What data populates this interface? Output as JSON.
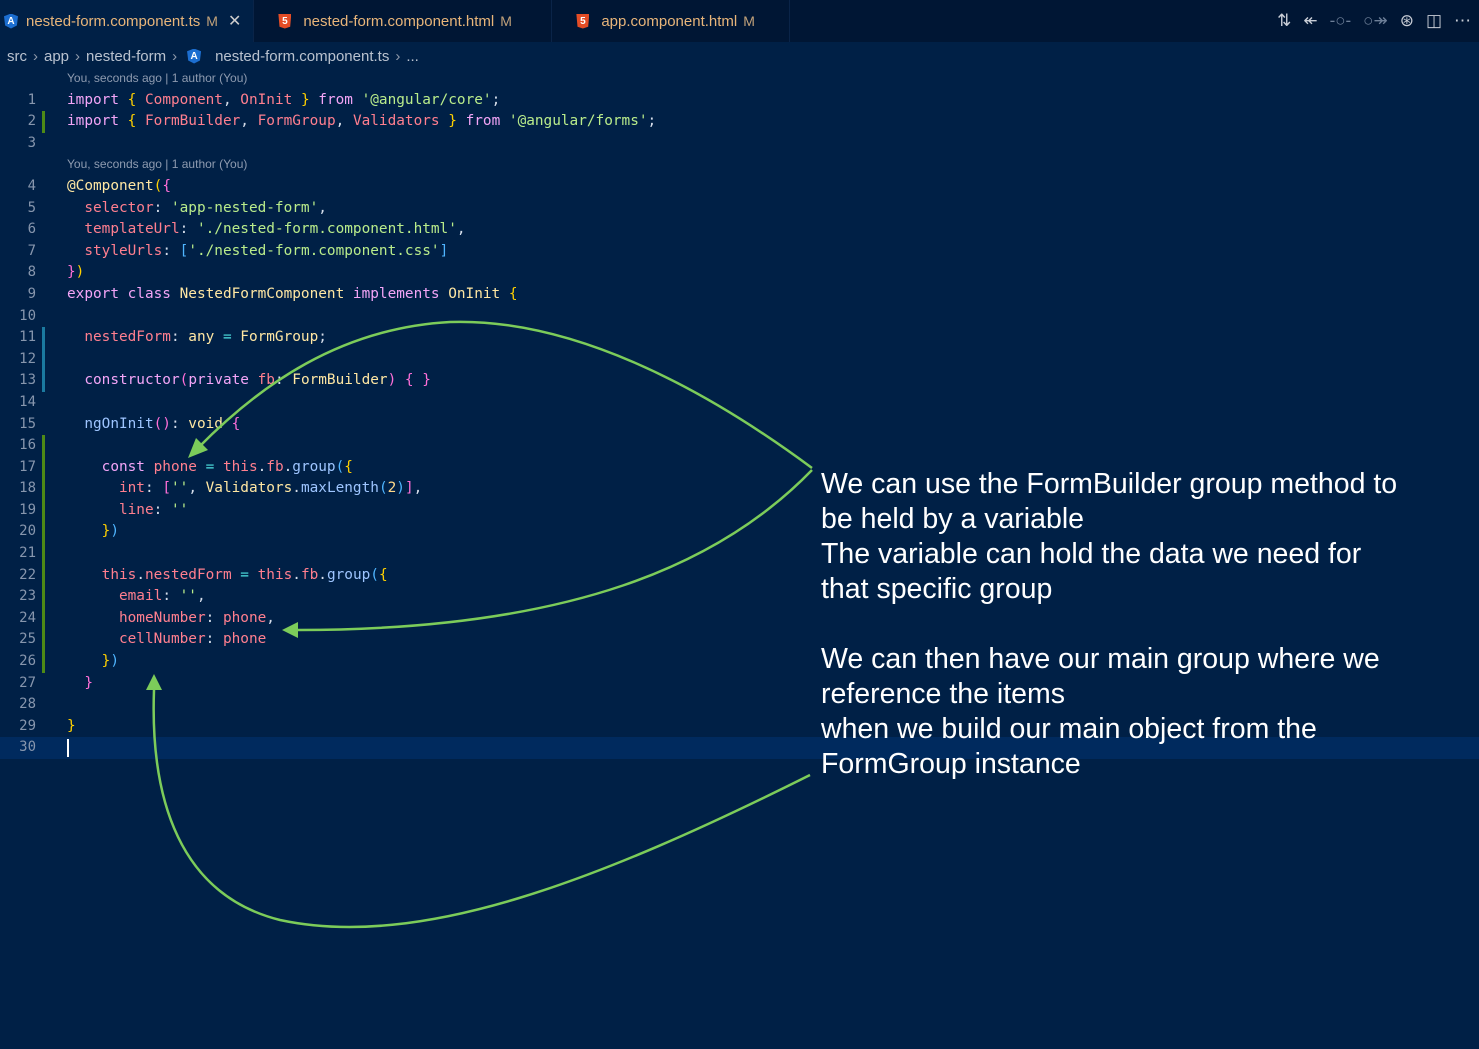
{
  "tabs": [
    {
      "label": "nested-form.component.ts",
      "badge": "M",
      "icon": "angular-icon",
      "active": true
    },
    {
      "label": "nested-form.component.html",
      "badge": "M",
      "icon": "html5-icon"
    },
    {
      "label": "app.component.html",
      "badge": "M",
      "icon": "html5-icon"
    }
  ],
  "breadcrumb": [
    "src",
    "app",
    "nested-form",
    "nested-form.component.ts",
    "..."
  ],
  "blame": "You, seconds ago | 1 author (You)",
  "colors": {
    "background": "#002046",
    "annotation_arrow": "#7ccc5a",
    "added_gutter": "#4e8a16",
    "modified_gutter": "#1b7aa0"
  },
  "lines": [
    [
      [
        "import",
        "kw"
      ],
      [
        " ",
        "pu"
      ],
      [
        "{",
        "br"
      ],
      [
        " Component",
        "id"
      ],
      [
        ",",
        "pu"
      ],
      [
        " OnInit ",
        "id"
      ],
      [
        "}",
        "br"
      ],
      [
        " from ",
        "kw"
      ],
      [
        "'@angular/core'",
        "str"
      ],
      [
        ";",
        "pu"
      ]
    ],
    [
      [
        "import",
        "kw"
      ],
      [
        " ",
        "pu"
      ],
      [
        "{",
        "br"
      ],
      [
        " FormBuilder",
        "id"
      ],
      [
        ",",
        "pu"
      ],
      [
        " FormGroup",
        "id"
      ],
      [
        ",",
        "pu"
      ],
      [
        " Validators ",
        "id"
      ],
      [
        "}",
        "br"
      ],
      [
        " from ",
        "kw"
      ],
      [
        "'@angular/forms'",
        "str"
      ],
      [
        ";",
        "pu"
      ]
    ],
    [],
    [
      [
        "@Component",
        "cls"
      ],
      [
        "(",
        "br"
      ],
      [
        "{",
        "pr"
      ]
    ],
    [
      [
        "  selector",
        "id"
      ],
      [
        ": ",
        "pu"
      ],
      [
        "'app-nested-form'",
        "str"
      ],
      [
        ",",
        "pu"
      ]
    ],
    [
      [
        "  templateUrl",
        "id"
      ],
      [
        ": ",
        "pu"
      ],
      [
        "'./nested-form.component.html'",
        "str"
      ],
      [
        ",",
        "pu"
      ]
    ],
    [
      [
        "  styleUrls",
        "id"
      ],
      [
        ": ",
        "pu"
      ],
      [
        "[",
        "sq"
      ],
      [
        "'./nested-form.component.css'",
        "str"
      ],
      [
        "]",
        "sq"
      ]
    ],
    [
      [
        "}",
        "pr"
      ],
      [
        ")",
        "br"
      ]
    ],
    [
      [
        "export class ",
        "kw"
      ],
      [
        "NestedFormComponent ",
        "cls"
      ],
      [
        "implements ",
        "kw"
      ],
      [
        "OnInit ",
        "cls"
      ],
      [
        "{",
        "br"
      ]
    ],
    [],
    [
      [
        "  nestedForm",
        "id"
      ],
      [
        ": ",
        "pu"
      ],
      [
        "any ",
        "cls"
      ],
      [
        "= ",
        "op"
      ],
      [
        "FormGroup",
        "cls"
      ],
      [
        ";",
        "pu"
      ]
    ],
    [],
    [
      [
        "  constructor",
        "kw"
      ],
      [
        "(",
        "pr"
      ],
      [
        "private ",
        "kw"
      ],
      [
        "fb",
        "id"
      ],
      [
        ": ",
        "pu"
      ],
      [
        "FormBuilder",
        "cls"
      ],
      [
        ")",
        "pr"
      ],
      [
        " { }",
        "pr"
      ]
    ],
    [],
    [
      [
        "  ngOnInit",
        "fn"
      ],
      [
        "()",
        "pr"
      ],
      [
        ": ",
        "pu"
      ],
      [
        "void ",
        "cls"
      ],
      [
        "{",
        "pr"
      ]
    ],
    [],
    [
      [
        "    const ",
        "kw"
      ],
      [
        "phone ",
        "id"
      ],
      [
        "= ",
        "op"
      ],
      [
        "this",
        "id"
      ],
      [
        ".",
        "pu"
      ],
      [
        "fb",
        "id"
      ],
      [
        ".",
        "pu"
      ],
      [
        "group",
        "fn"
      ],
      [
        "(",
        "sq"
      ],
      [
        "{",
        "br"
      ]
    ],
    [
      [
        "      int",
        "id"
      ],
      [
        ": ",
        "pu"
      ],
      [
        "[",
        "pr"
      ],
      [
        "''",
        "str"
      ],
      [
        ", ",
        "pu"
      ],
      [
        "Validators",
        "cls"
      ],
      [
        ".",
        "pu"
      ],
      [
        "maxLength",
        "fn"
      ],
      [
        "(",
        "sq"
      ],
      [
        "2",
        "num"
      ],
      [
        ")",
        "sq"
      ],
      [
        "]",
        "pr"
      ],
      [
        ",",
        "pu"
      ]
    ],
    [
      [
        "      line",
        "id"
      ],
      [
        ": ",
        "pu"
      ],
      [
        "''",
        "str"
      ]
    ],
    [
      [
        "    }",
        "br"
      ],
      [
        ")",
        "sq"
      ]
    ],
    [],
    [
      [
        "    this",
        "id"
      ],
      [
        ".",
        "pu"
      ],
      [
        "nestedForm ",
        "id"
      ],
      [
        "= ",
        "op"
      ],
      [
        "this",
        "id"
      ],
      [
        ".",
        "pu"
      ],
      [
        "fb",
        "id"
      ],
      [
        ".",
        "pu"
      ],
      [
        "group",
        "fn"
      ],
      [
        "(",
        "sq"
      ],
      [
        "{",
        "br"
      ]
    ],
    [
      [
        "      email",
        "id"
      ],
      [
        ": ",
        "pu"
      ],
      [
        "''",
        "str"
      ],
      [
        ",",
        "pu"
      ]
    ],
    [
      [
        "      homeNumber",
        "id"
      ],
      [
        ": ",
        "pu"
      ],
      [
        "phone",
        "id"
      ],
      [
        ",",
        "pu"
      ]
    ],
    [
      [
        "      cellNumber",
        "id"
      ],
      [
        ": ",
        "pu"
      ],
      [
        "phone",
        "id"
      ]
    ],
    [
      [
        "    }",
        "br"
      ],
      [
        ")",
        "sq"
      ]
    ],
    [
      [
        "  }",
        "pr"
      ]
    ],
    [],
    [
      [
        "}",
        "br"
      ]
    ],
    []
  ],
  "note": "We can use the FormBuilder group method to\nbe held by a variable\nThe variable can hold the data we need for\nthat specific group\n\nWe can then have our main group where we\nreference the items\nwhen we build our main object from the\nFormGroup instance"
}
